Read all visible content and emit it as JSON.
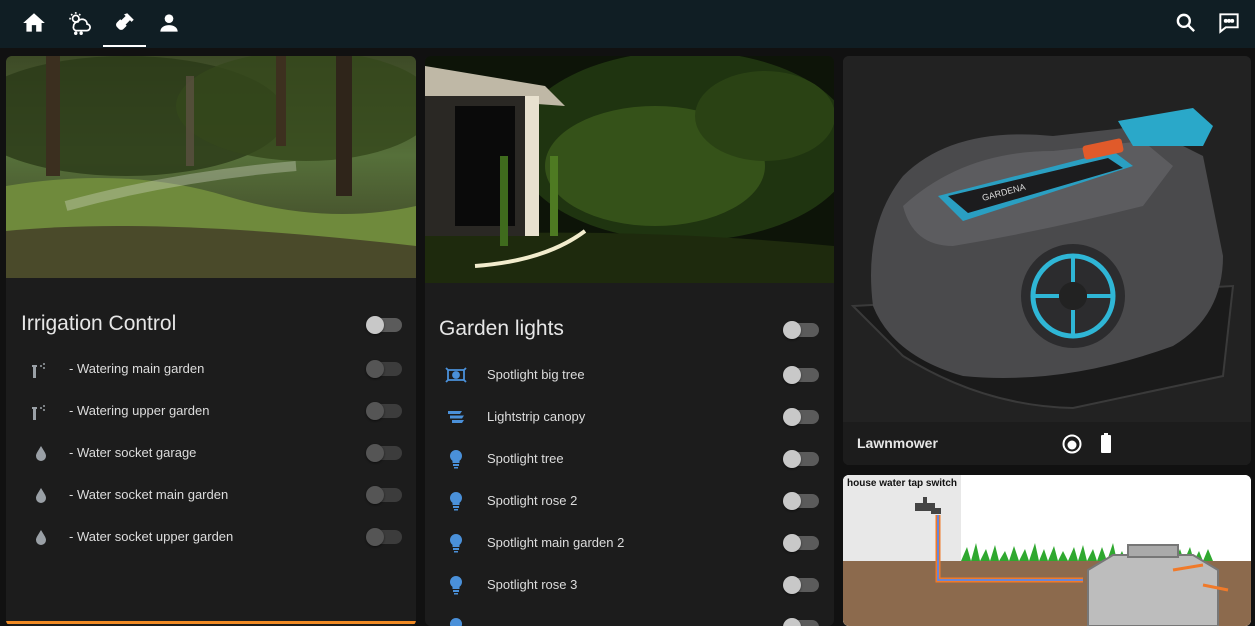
{
  "irrigation": {
    "title": "Irrigation Control",
    "items": [
      {
        "label": "- Watering main garden",
        "icon": "sprinkler-icon"
      },
      {
        "label": "- Watering upper garden",
        "icon": "sprinkler-icon"
      },
      {
        "label": "- Water socket garage",
        "icon": "water-drop-icon"
      },
      {
        "label": "- Water socket main garden",
        "icon": "water-drop-icon"
      },
      {
        "label": "- Water socket upper garden",
        "icon": "water-drop-icon"
      }
    ]
  },
  "lights": {
    "title": "Garden lights",
    "items": [
      {
        "label": "Spotlight big tree",
        "icon": "spotlight-icon"
      },
      {
        "label": "Lightstrip canopy",
        "icon": "lightstrip-icon"
      },
      {
        "label": "Spotlight tree",
        "icon": "bulb-icon"
      },
      {
        "label": "Spotlight rose 2",
        "icon": "bulb-icon"
      },
      {
        "label": "Spotlight main garden 2",
        "icon": "bulb-icon"
      },
      {
        "label": "Spotlight rose 3",
        "icon": "bulb-icon"
      }
    ]
  },
  "mower": {
    "name": "Lawnmower",
    "brand": "GARDENA"
  },
  "water_tap": {
    "label": "house water tap switch"
  },
  "colors": {
    "accent": "#4a90d9",
    "topbar": "#101e24",
    "card": "#1c1c1c",
    "progress": "#f08a24"
  }
}
